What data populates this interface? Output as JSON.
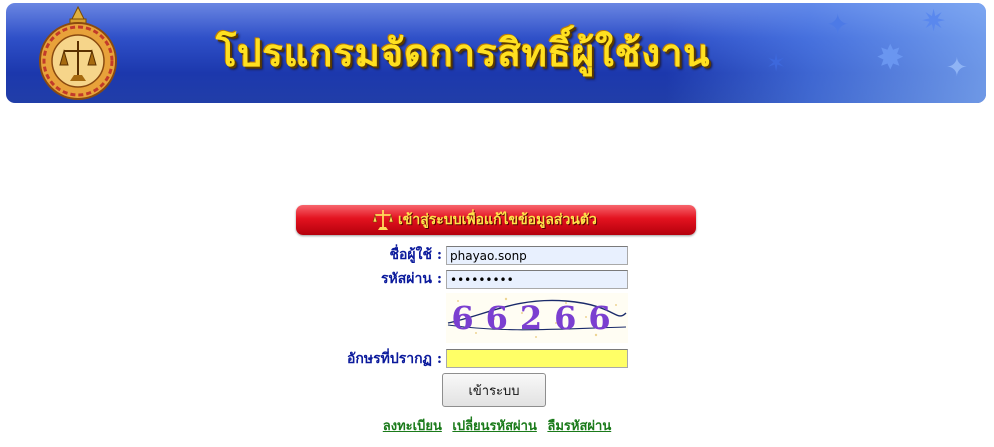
{
  "banner": {
    "title": "โปรแกรมจัดการสิทธิ์ผู้ใช้งาน",
    "emblem_icon": "court-emblem-icon",
    "colors": {
      "background": "#2f50c8",
      "title_text": "#ffe020"
    }
  },
  "login": {
    "header_text": "เข้าสู่ระบบเพื่อแก้ไขข้อมูลส่วนตัว",
    "header_icon": "scales-of-justice-icon",
    "header_color": "#e3121f",
    "username_label": "ชื่อผู้ใช้ :",
    "username_value": "phayao.sonp",
    "password_label": "รหัสผ่าน :",
    "password_value": "•••••••••",
    "captcha_text": "66266",
    "captcha_label": "อักษรที่ปรากฏ :",
    "captcha_value": "",
    "submit_label": "เข้าระบบ",
    "label_color": "#0b1a9c"
  },
  "links": {
    "register": "ลงทะเบียน",
    "change_password": "เปลี่ยนรหัสผ่าน",
    "forgot_password": "ลืมรหัสผ่าน",
    "color": "#1a7a1a"
  }
}
